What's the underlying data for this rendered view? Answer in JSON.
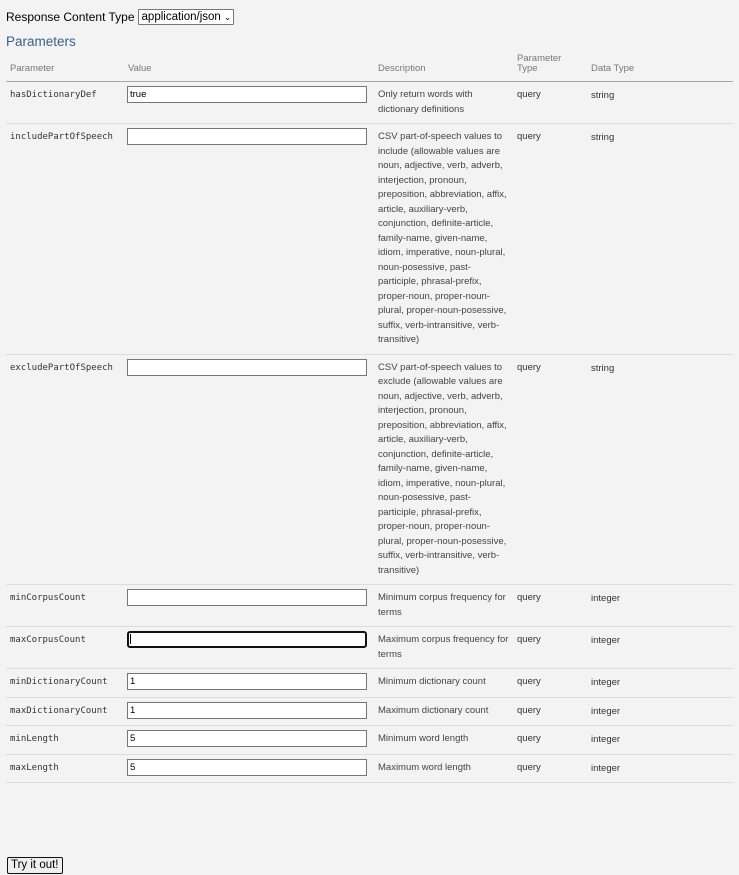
{
  "response_content_type": {
    "label": "Response Content Type",
    "selected": "application/json"
  },
  "parameters_title": "Parameters",
  "table": {
    "headers": {
      "parameter": "Parameter",
      "value": "Value",
      "description": "Description",
      "param_type_line1": "Parameter",
      "param_type_line2": "Type",
      "data_type": "Data Type"
    },
    "rows": [
      {
        "name": "hasDictionaryDef",
        "value": "true",
        "description": "Only return words with dictionary definitions",
        "param_type": "query",
        "data_type": "string"
      },
      {
        "name": "includePartOfSpeech",
        "value": "",
        "description": "CSV part-of-speech values to include (allowable values are noun, adjective, verb, adverb, interjection, pronoun, preposition, abbreviation, affix, article, auxiliary-verb, conjunction, definite-article, family-name, given-name, idiom, imperative, noun-plural, noun-posessive, past-participle, phrasal-prefix, proper-noun, proper-noun-plural, proper-noun-posessive, suffix, verb-intransitive, verb-transitive)",
        "param_type": "query",
        "data_type": "string"
      },
      {
        "name": "excludePartOfSpeech",
        "value": "",
        "description": "CSV part-of-speech values to exclude (allowable values are noun, adjective, verb, adverb, interjection, pronoun, preposition, abbreviation, affix, article, auxiliary-verb, conjunction, definite-article, family-name, given-name, idiom, imperative, noun-plural, noun-posessive, past-participle, phrasal-prefix, proper-noun, proper-noun-plural, proper-noun-posessive, suffix, verb-intransitive, verb-transitive)",
        "param_type": "query",
        "data_type": "string"
      },
      {
        "name": "minCorpusCount",
        "value": "",
        "description": "Minimum corpus frequency for terms",
        "param_type": "query",
        "data_type": "integer"
      },
      {
        "name": "maxCorpusCount",
        "value": "",
        "description": "Maximum corpus frequency for terms",
        "param_type": "query",
        "data_type": "integer"
      },
      {
        "name": "minDictionaryCount",
        "value": "1",
        "description": "Minimum dictionary count",
        "param_type": "query",
        "data_type": "integer"
      },
      {
        "name": "maxDictionaryCount",
        "value": "1",
        "description": "Maximum dictionary count",
        "param_type": "query",
        "data_type": "integer"
      },
      {
        "name": "minLength",
        "value": "5",
        "description": "Minimum word length",
        "param_type": "query",
        "data_type": "integer"
      },
      {
        "name": "maxLength",
        "value": "5",
        "description": "Maximum word length",
        "param_type": "query",
        "data_type": "integer"
      }
    ]
  },
  "try_button": "Try it out!"
}
